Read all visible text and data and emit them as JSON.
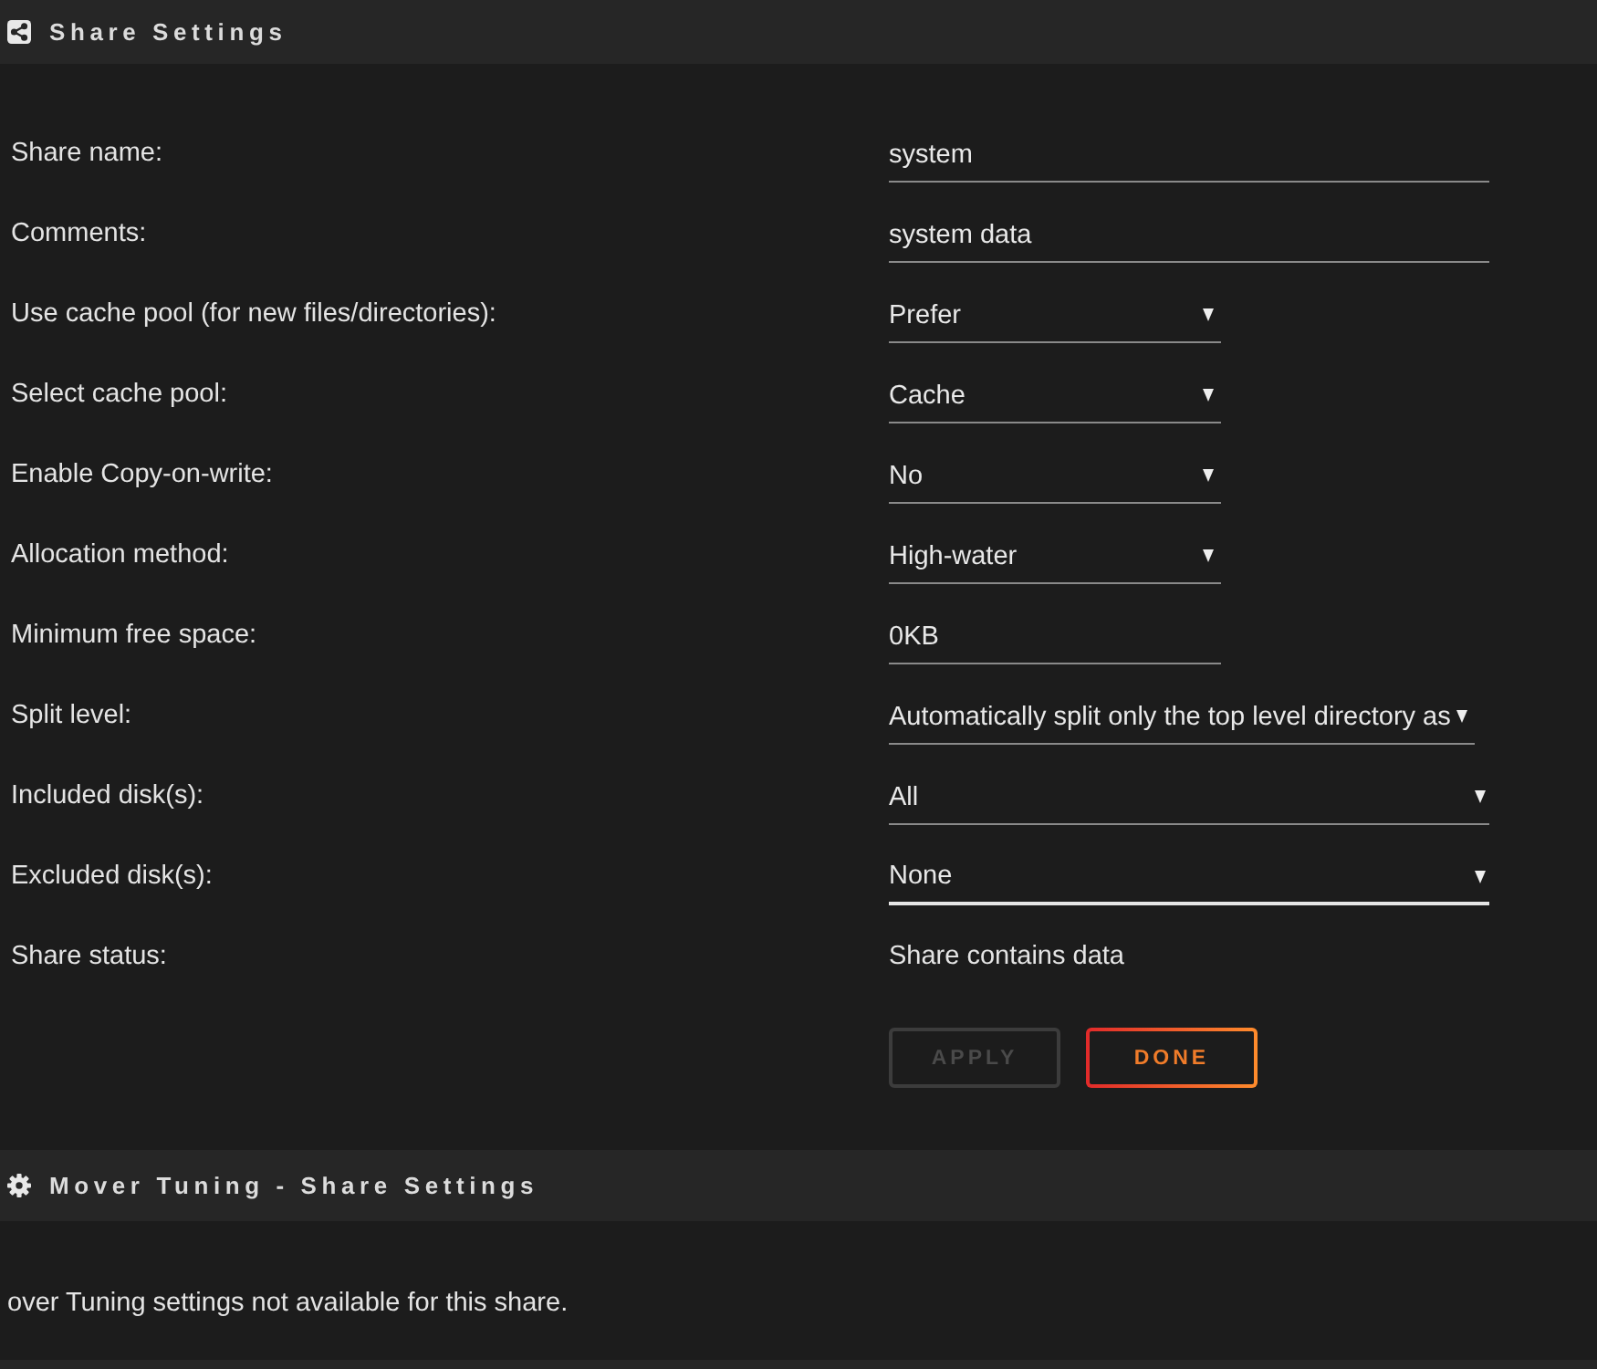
{
  "share_settings": {
    "title": "Share Settings",
    "rows": [
      {
        "kind": "input",
        "label": "Share name:",
        "value": "system",
        "focused": false
      },
      {
        "kind": "input",
        "label": "Comments:",
        "value": "system data",
        "focused": false
      },
      {
        "kind": "select",
        "label": "Use cache pool (for new files/directories):",
        "value": "Prefer",
        "focused": false
      },
      {
        "kind": "select",
        "label": "Select cache pool:",
        "value": "Cache",
        "focused": false
      },
      {
        "kind": "select",
        "label": "Enable Copy-on-write:",
        "value": "No",
        "focused": false
      },
      {
        "kind": "select",
        "label": "Allocation method:",
        "value": "High-water",
        "focused": false
      },
      {
        "kind": "input-short",
        "label": "Minimum free space:",
        "value": "0KB",
        "focused": false
      },
      {
        "kind": "select",
        "label": "Split level:",
        "value": "Automatically split only the top level directory as",
        "focused": false
      },
      {
        "kind": "multiselect",
        "label": "Included disk(s):",
        "value": "All",
        "focused": false
      },
      {
        "kind": "multiselect",
        "label": "Excluded disk(s):",
        "value": "None",
        "focused": true
      },
      {
        "kind": "text",
        "label": "Share status:",
        "value": "Share contains data"
      }
    ],
    "buttons": [
      {
        "label": "APPLY",
        "disabled": true
      },
      {
        "label": "DONE",
        "disabled": false
      }
    ]
  },
  "mover_tuning": {
    "title": "Mover Tuning - Share Settings",
    "message": "over Tuning settings not available for this share."
  }
}
